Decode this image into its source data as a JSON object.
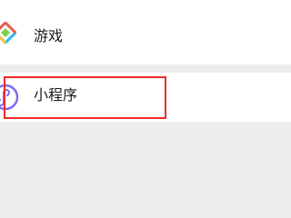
{
  "list": {
    "items": [
      {
        "label": "游戏",
        "icon": "games-diamond-icon"
      },
      {
        "label": "小程序",
        "icon": "mini-program-icon"
      }
    ]
  },
  "highlight": {
    "color": "#ef2a2a",
    "target": "小程序"
  },
  "colors": {
    "background": "#ededed",
    "row_background": "#ffffff",
    "games_icon_colors": [
      "#f05a50",
      "#f5c64a",
      "#2db7f5",
      "#7fcf4a"
    ],
    "mini_program_icon_color": "#7b6ef0"
  }
}
